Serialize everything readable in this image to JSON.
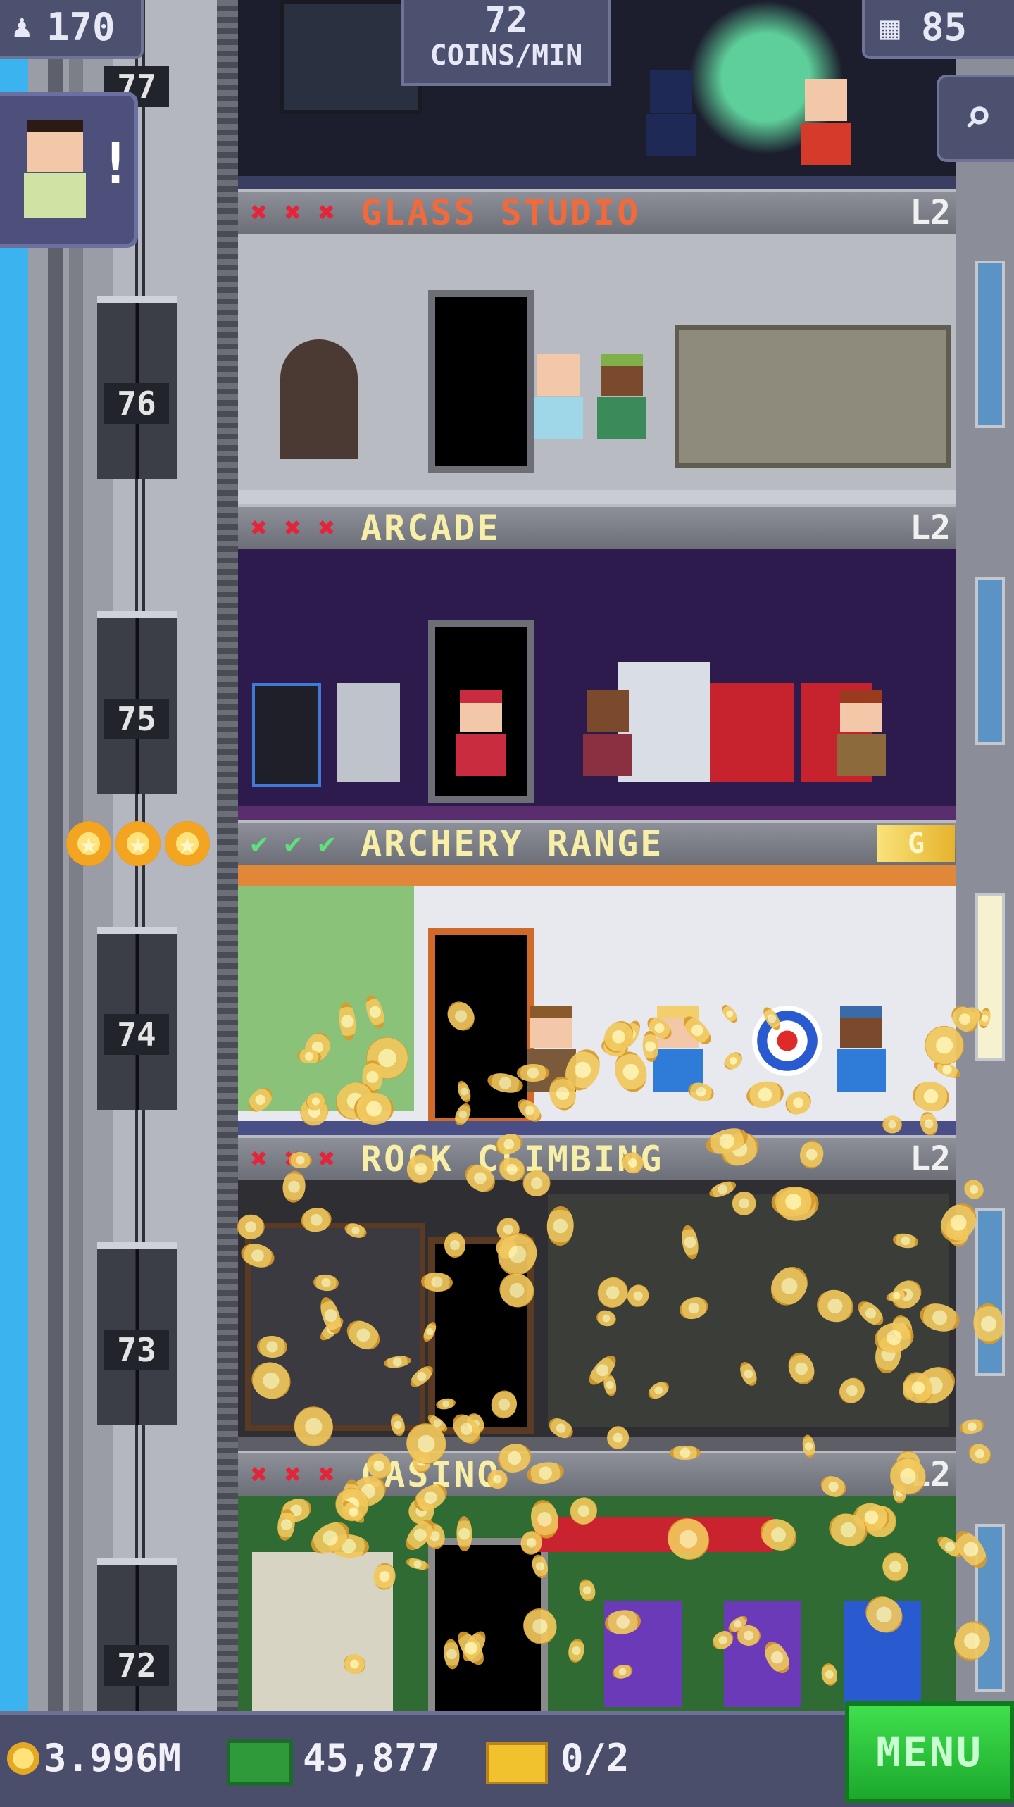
{
  "top_bar": {
    "population": "170",
    "coins_per_min_value": "72",
    "coins_per_min_label": "COINS/MIN",
    "floors": "85",
    "population_icon": "person-icon",
    "floors_icon": "building-icon",
    "search_icon": "magnifier-icon"
  },
  "notification": {
    "icon": "visitor-avatar-icon",
    "mark": "!"
  },
  "elevator": {
    "floor_numbers": [
      "77",
      "76",
      "75",
      "74",
      "73",
      "72"
    ],
    "stars": [
      "★",
      "★",
      "★"
    ]
  },
  "floors": [
    {
      "name": "GLASS STUDIO",
      "level": "L2",
      "marks": [
        "✖",
        "✖",
        "✖"
      ],
      "mark_type": "x",
      "name_color": "#f06a3c",
      "room_color": "#b9bbc2"
    },
    {
      "name": "ARCADE",
      "level": "L2",
      "marks": [
        "✖",
        "✖",
        "✖"
      ],
      "mark_type": "x",
      "name_color": "#f7efa8",
      "room_color": "#2d1b4e"
    },
    {
      "name": "ARCHERY RANGE",
      "level": "G",
      "marks": [
        "✔",
        "✔",
        "✔"
      ],
      "mark_type": "check",
      "name_color": "#f7efa8",
      "room_color": "#e8e9ee"
    },
    {
      "name": "ROCK CLIMBING",
      "level": "L2",
      "marks": [
        "✖",
        "✖",
        "✖"
      ],
      "mark_type": "x",
      "name_color": "#f7efa8",
      "room_color": "#2f2f33"
    },
    {
      "name": "CASINO",
      "level": "L2",
      "marks": [
        "✖",
        "✖",
        "✖"
      ],
      "mark_type": "x",
      "name_color": "#f7efa8",
      "room_color": "#2f6b32"
    }
  ],
  "bottom_bar": {
    "coins": "3.996M",
    "bux": "45,877",
    "tickets": "0/2",
    "coins_icon": "coin-icon",
    "bux_icon": "tower-bux-icon",
    "tickets_icon": "vip-ticket-icon",
    "menu_label": "MENU"
  }
}
